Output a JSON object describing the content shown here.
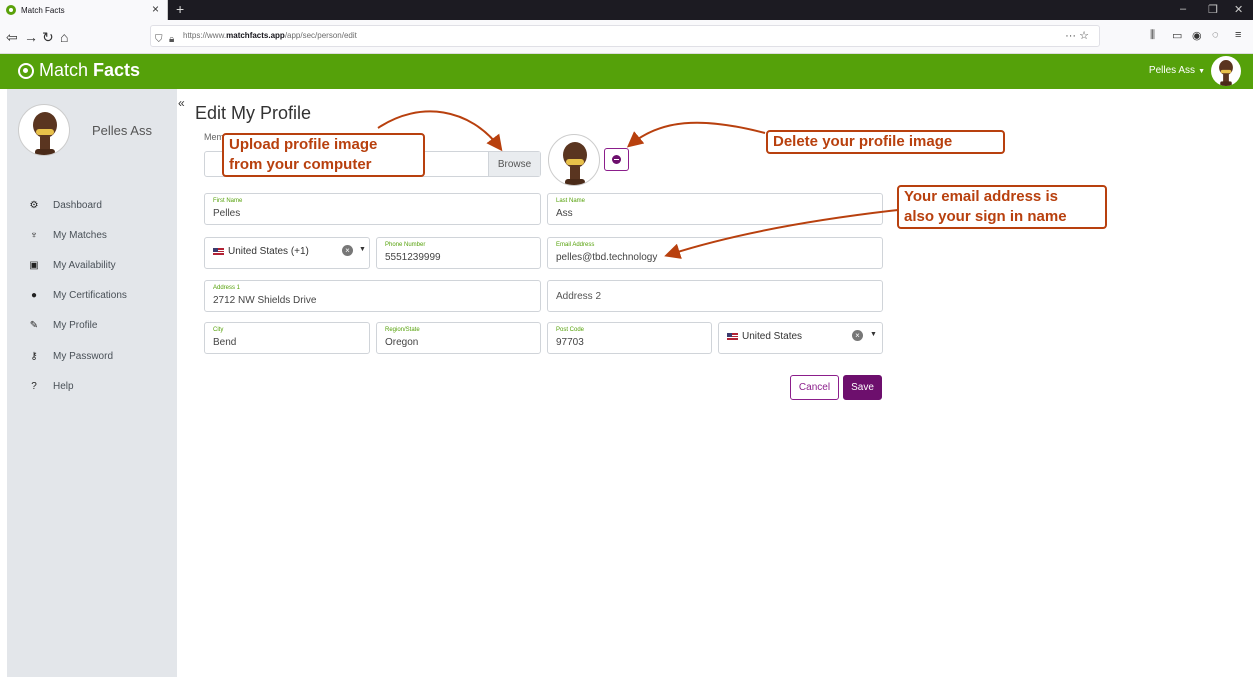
{
  "browser": {
    "tab_title": "Match Facts",
    "url_prefix": "https://www.",
    "url_host": "matchfacts.app",
    "url_path": "/app/sec/person/edit",
    "url_actions": "··· ☆"
  },
  "header": {
    "brand_light": "Match",
    "brand_bold": "Facts",
    "user_name": "Pelles Ass",
    "caret": "▼"
  },
  "sidebar": {
    "user_name": "Pelles Ass",
    "collapse": "«",
    "items": [
      {
        "label": "Dashboard",
        "icon": "dashboard-icon",
        "glyph": "⚙"
      },
      {
        "label": "My Matches",
        "icon": "trophy-icon",
        "glyph": "♆"
      },
      {
        "label": "My Availability",
        "icon": "calendar-icon",
        "glyph": "▣"
      },
      {
        "label": "My Certifications",
        "icon": "certificate-icon",
        "glyph": "●"
      },
      {
        "label": "My Profile",
        "icon": "pencil-icon",
        "glyph": "✎"
      },
      {
        "label": "My Password",
        "icon": "key-icon",
        "glyph": "⚷"
      },
      {
        "label": "Help",
        "icon": "question-icon",
        "glyph": "?"
      }
    ]
  },
  "form": {
    "title": "Edit My Profile",
    "member_image_label": "Member Image",
    "browse_label": "Browse",
    "first_name": {
      "label": "First Name",
      "value": "Pelles"
    },
    "last_name": {
      "label": "Last Name",
      "value": "Ass"
    },
    "phone_country": "United States (+1)",
    "phone": {
      "label": "Phone Number",
      "value": "5551239999"
    },
    "email": {
      "label": "Email Address",
      "value": "pelles@tbd.technology"
    },
    "address1": {
      "label": "Address 1",
      "value": "2712 NW Shields Drive"
    },
    "address2_placeholder": "Address 2",
    "city": {
      "label": "City",
      "value": "Bend"
    },
    "region": {
      "label": "Region/State",
      "value": "Oregon"
    },
    "post_code": {
      "label": "Post Code",
      "value": "97703"
    },
    "country": "United States",
    "clear_glyph": "×",
    "cancel_label": "Cancel",
    "save_label": "Save"
  },
  "annotations": {
    "upload_line1": "Upload profile image",
    "upload_line2": "from your computer",
    "delete": "Delete your profile image",
    "email_line1": "Your email address is",
    "email_line2": "also your sign in name"
  },
  "colors": {
    "brand_green": "#55a10a",
    "accent_purple": "#6d0f6d",
    "annotation_orange": "#b8400e"
  }
}
